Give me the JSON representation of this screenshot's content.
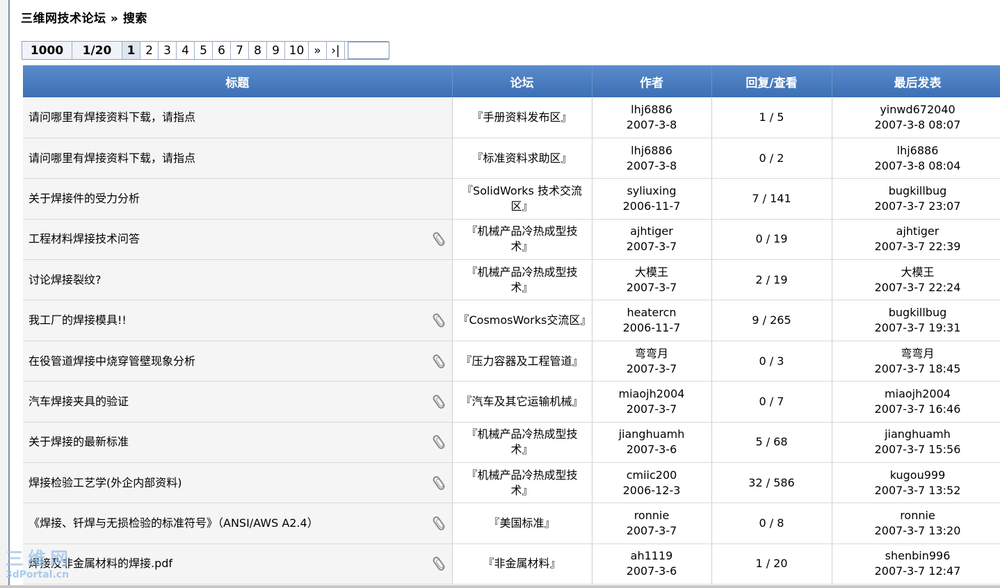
{
  "breadcrumb": "三维网技术论坛 » 搜索",
  "pager": {
    "total": "1000",
    "page_of": "1/20",
    "pages": [
      "1",
      "2",
      "3",
      "4",
      "5",
      "6",
      "7",
      "8",
      "9",
      "10"
    ],
    "current": "1",
    "next": "»",
    "last": "›|",
    "jump_value": ""
  },
  "columns": [
    "标题",
    "论坛",
    "作者",
    "回复/查看",
    "最后发表"
  ],
  "rows": [
    {
      "title": "请问哪里有焊接资料下载，请指点",
      "forum": "『手册资料发布区』",
      "author": "lhj6886",
      "date": "2007-3-8",
      "stats": "1 / 5",
      "last_user": "yinwd672040",
      "last_time": "2007-3-8 08:07",
      "attach": false
    },
    {
      "title": "请问哪里有焊接资料下载，请指点",
      "forum": "『标准资料求助区』",
      "author": "lhj6886",
      "date": "2007-3-8",
      "stats": "0 / 2",
      "last_user": "lhj6886",
      "last_time": "2007-3-8 08:04",
      "attach": false
    },
    {
      "title": "关于焊接件的受力分析",
      "forum": "『SolidWorks 技术交流区』",
      "author": "syliuxing",
      "date": "2006-11-7",
      "stats": "7 / 141",
      "last_user": "bugkillbug",
      "last_time": "2007-3-7 23:07",
      "attach": false
    },
    {
      "title": "工程材料焊接技术问答",
      "forum": "『机械产品冷热成型技术』",
      "author": "ajhtiger",
      "date": "2007-3-7",
      "stats": "0 / 19",
      "last_user": "ajhtiger",
      "last_time": "2007-3-7 22:39",
      "attach": true
    },
    {
      "title": "讨论焊接裂纹?",
      "forum": "『机械产品冷热成型技术』",
      "author": "大模王",
      "date": "2007-3-7",
      "stats": "2 / 19",
      "last_user": "大模王",
      "last_time": "2007-3-7 22:24",
      "attach": false
    },
    {
      "title": "我工厂的焊接模具!!",
      "forum": "『CosmosWorks交流区』",
      "author": "heatercn",
      "date": "2006-11-7",
      "stats": "9 / 265",
      "last_user": "bugkillbug",
      "last_time": "2007-3-7 19:31",
      "attach": true
    },
    {
      "title": "在役管道焊接中烧穿管壁现象分析",
      "forum": "『压力容器及工程管道』",
      "author": "弯弯月",
      "date": "2007-3-7",
      "stats": "0 / 3",
      "last_user": "弯弯月",
      "last_time": "2007-3-7 18:45",
      "attach": true
    },
    {
      "title": "汽车焊接夹具的验证",
      "forum": "『汽车及其它运输机械』",
      "author": "miaojh2004",
      "date": "2007-3-7",
      "stats": "0 / 7",
      "last_user": "miaojh2004",
      "last_time": "2007-3-7 16:46",
      "attach": true
    },
    {
      "title": "关于焊接的最新标准",
      "forum": "『机械产品冷热成型技术』",
      "author": "jianghuamh",
      "date": "2007-3-6",
      "stats": "5 / 68",
      "last_user": "jianghuamh",
      "last_time": "2007-3-7 15:56",
      "attach": true
    },
    {
      "title": "焊接检验工艺学(外企内部资料)",
      "forum": "『机械产品冷热成型技术』",
      "author": "cmiic200",
      "date": "2006-12-3",
      "stats": "32 / 586",
      "last_user": "kugou999",
      "last_time": "2007-3-7 13:52",
      "attach": true
    },
    {
      "title": "《焊接、钎焊与无损检验的标准符号》（ANSI/AWS A2.4）",
      "forum": "『美国标准』",
      "author": "ronnie",
      "date": "2007-3-7",
      "stats": "0 / 8",
      "last_user": "ronnie",
      "last_time": "2007-3-7 13:20",
      "attach": true
    },
    {
      "title": "焊接及非金属材料的焊接.pdf",
      "forum": "『非金属材料』",
      "author": "ah1119",
      "date": "2007-3-6",
      "stats": "1 / 20",
      "last_user": "shenbin996",
      "last_time": "2007-3-7 12:47",
      "attach": true
    }
  ],
  "watermark": {
    "big": "三维网",
    "small": "3dPortal.cn"
  }
}
